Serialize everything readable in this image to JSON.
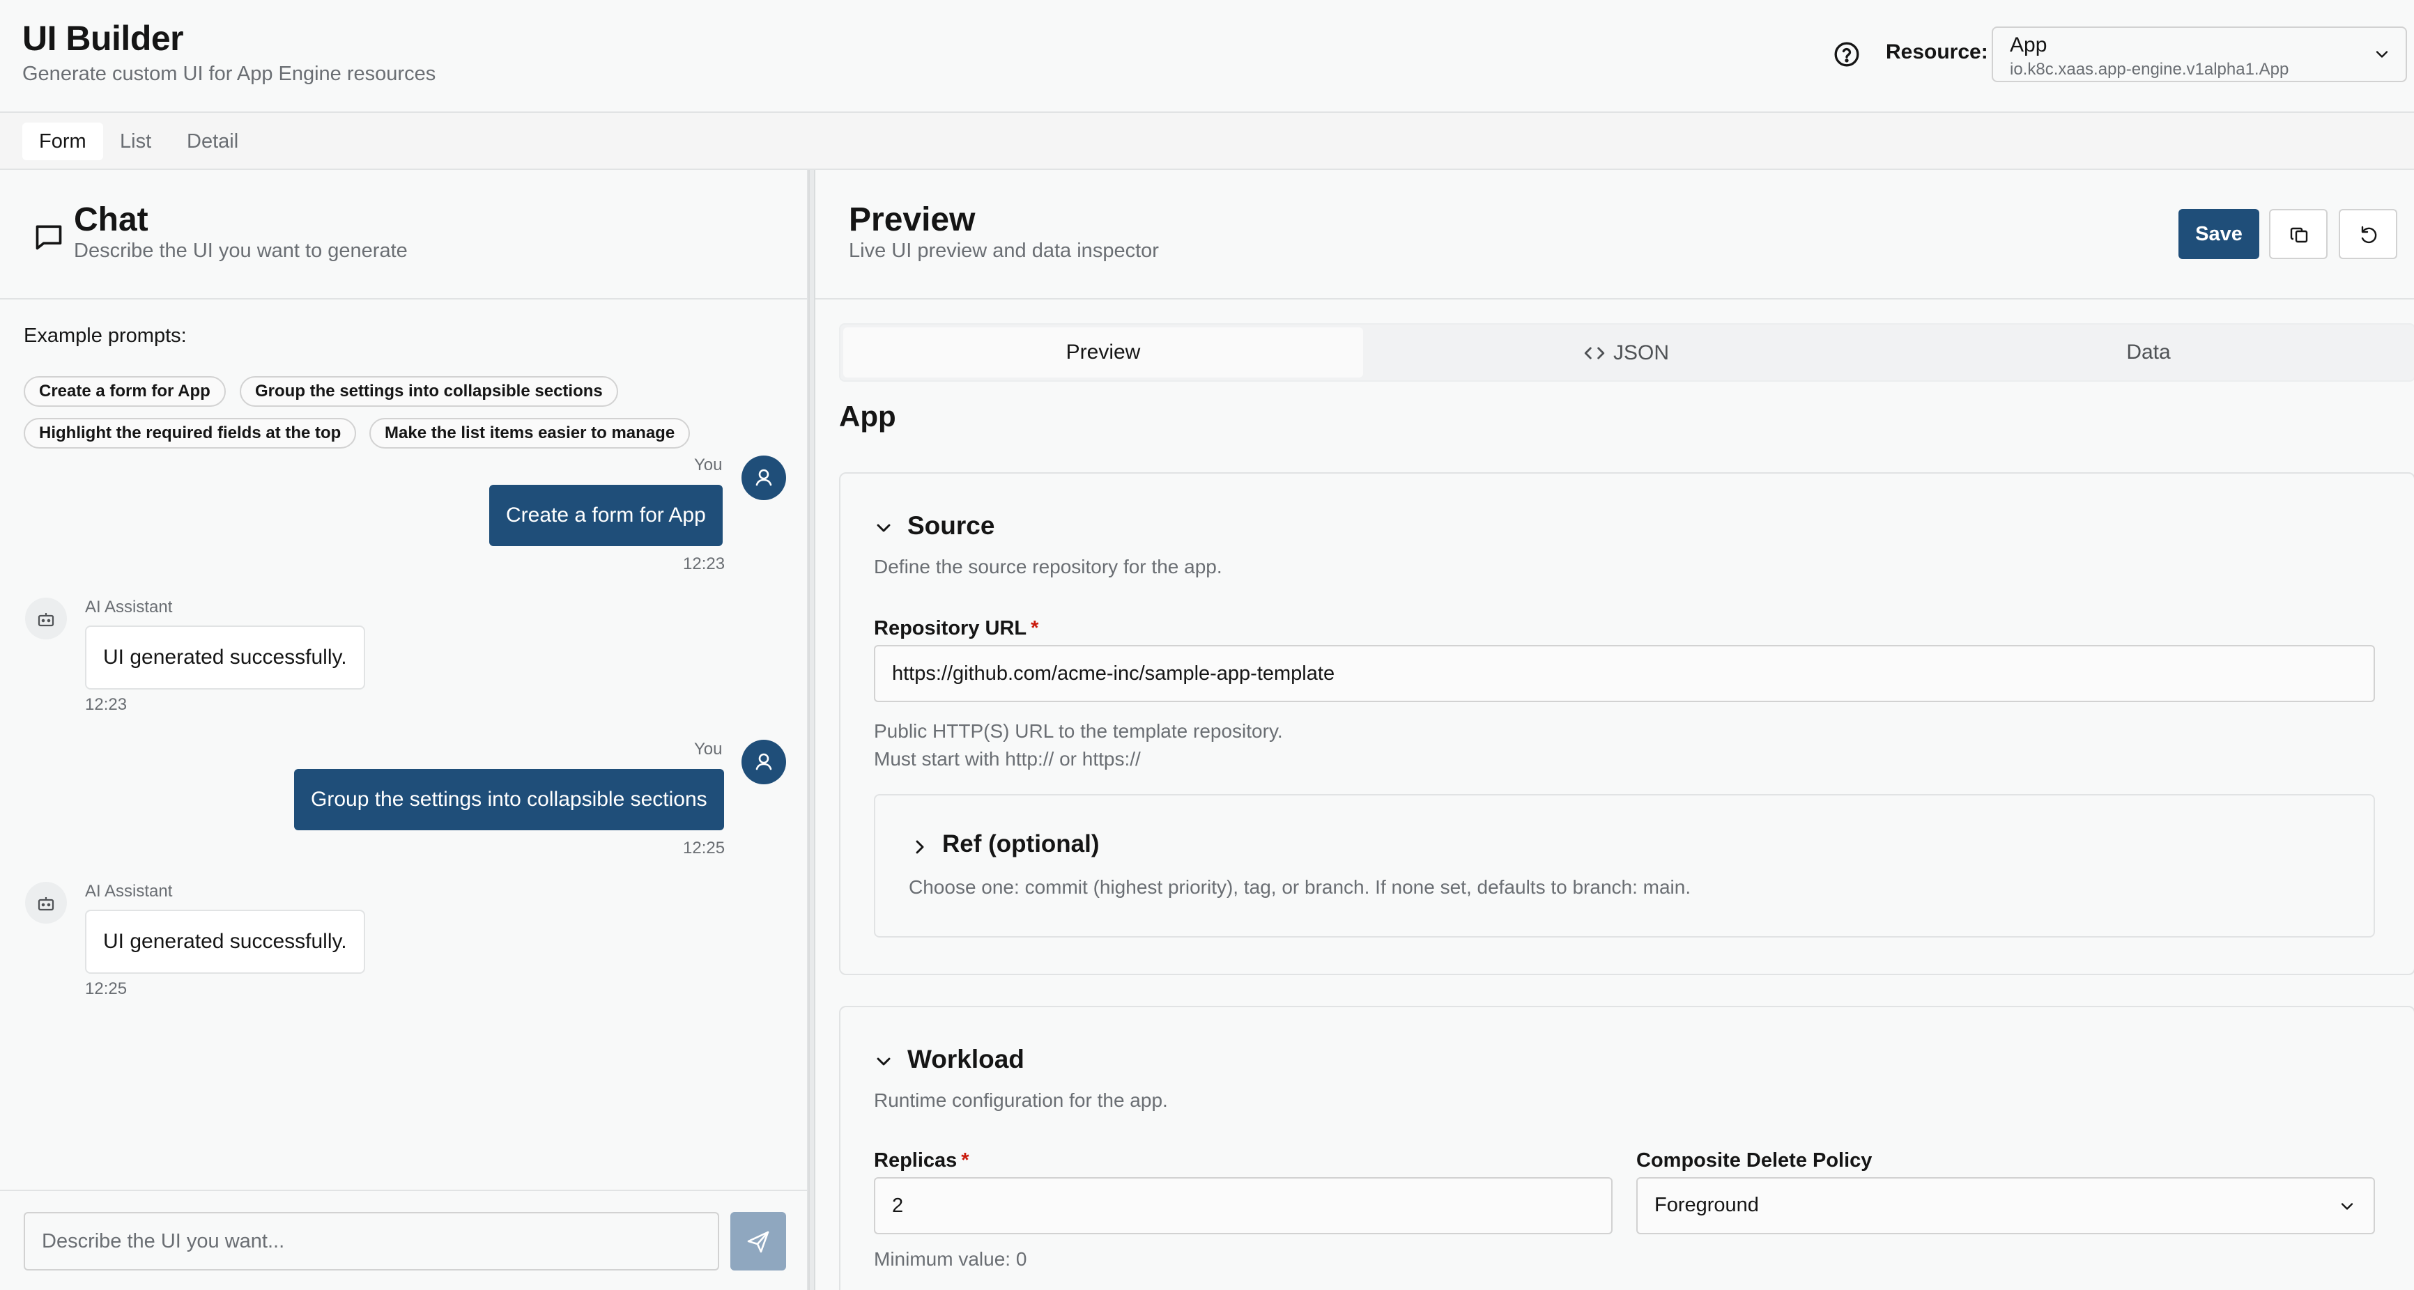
{
  "header": {
    "title": "UI Builder",
    "subtitle": "Generate custom UI for App Engine resources",
    "resource_label": "Resource:",
    "resource_name": "App",
    "resource_kind": "io.k8c.xaas.app-engine.v1alpha1.App"
  },
  "top_tabs": [
    {
      "label": "Form",
      "active": true
    },
    {
      "label": "List",
      "active": false
    },
    {
      "label": "Detail",
      "active": false
    }
  ],
  "chat": {
    "title": "Chat",
    "subtitle": "Describe the UI you want to generate",
    "examples_label": "Example prompts:",
    "examples": [
      "Create a form for App",
      "Group the settings into collapsible sections",
      "Highlight the required fields at the top",
      "Make the list items easier to manage"
    ],
    "messages": [
      {
        "role": "user",
        "author": "You",
        "text": "Create a form for App",
        "time": "12:23"
      },
      {
        "role": "assistant",
        "author": "AI Assistant",
        "text": "UI generated successfully.",
        "time": "12:23"
      },
      {
        "role": "user",
        "author": "You",
        "text": "Group the settings into collapsible sections",
        "time": "12:25"
      },
      {
        "role": "assistant",
        "author": "AI Assistant",
        "text": "UI generated successfully.",
        "time": "12:25"
      }
    ],
    "input_placeholder": "Describe the UI you want..."
  },
  "preview": {
    "title": "Preview",
    "subtitle": "Live UI preview and data inspector",
    "save_label": "Save",
    "tabs": [
      {
        "label": "Preview",
        "active": true
      },
      {
        "label": "JSON",
        "active": false
      },
      {
        "label": "Data",
        "active": false
      }
    ],
    "form_title": "App",
    "source": {
      "title": "Source",
      "description": "Define the source repository for the app.",
      "repo_label": "Repository URL",
      "repo_required": "*",
      "repo_value": "https://github.com/acme-inc/sample-app-template",
      "repo_help_1": "Public HTTP(S) URL to the template repository.",
      "repo_help_2": "Must start with http:// or https://",
      "ref_title": "Ref (optional)",
      "ref_description": "Choose one: commit (highest priority), tag, or branch. If none set, defaults to branch: main."
    },
    "workload": {
      "title": "Workload",
      "description": "Runtime configuration for the app.",
      "replicas_label": "Replicas",
      "replicas_required": "*",
      "replicas_value": "2",
      "replicas_help": "Minimum value: 0",
      "policy_label": "Composite Delete Policy",
      "policy_value": "Foreground"
    }
  },
  "colors": {
    "accent": "#1f4e79",
    "required": "#c9190b",
    "muted_text": "#6a6e73"
  }
}
